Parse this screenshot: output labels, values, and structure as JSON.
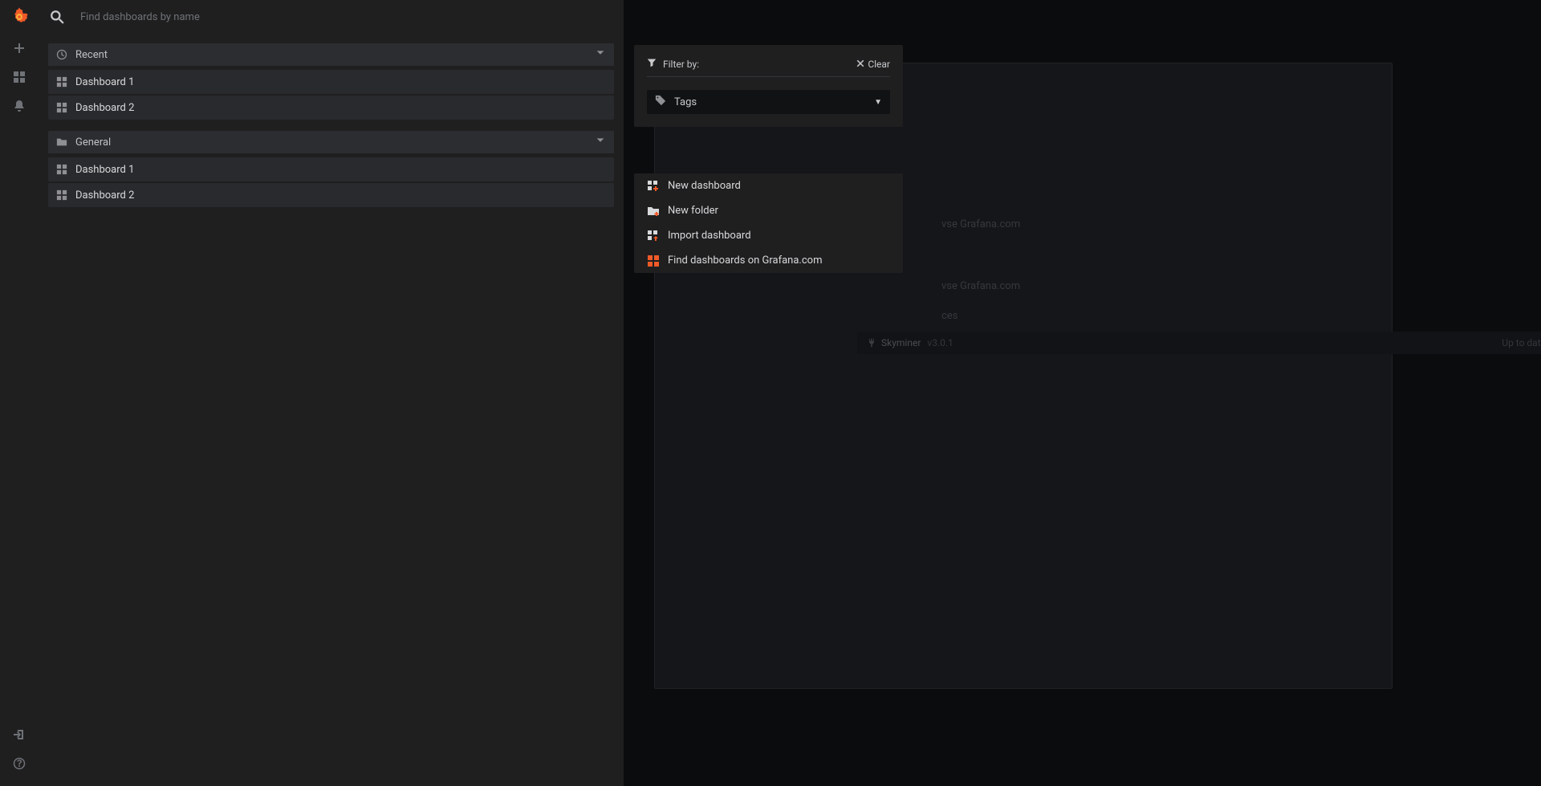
{
  "search": {
    "placeholder": "Find dashboards by name"
  },
  "sections": [
    {
      "key": "recent",
      "title": "Recent",
      "icon": "clock",
      "items": [
        {
          "label": "Dashboard 1"
        },
        {
          "label": "Dashboard 2"
        }
      ]
    },
    {
      "key": "general",
      "title": "General",
      "icon": "folder",
      "items": [
        {
          "label": "Dashboard 1"
        },
        {
          "label": "Dashboard 2"
        }
      ]
    }
  ],
  "filter": {
    "title": "Filter by:",
    "clear": "Clear",
    "tags_label": "Tags"
  },
  "actions": {
    "new_dashboard": "New dashboard",
    "new_folder": "New folder",
    "import_dashboard": "Import dashboard",
    "find_on_grafana": "Find dashboards on Grafana.com"
  },
  "background": {
    "browse1": "vse Grafana.com",
    "browse2": "vse Grafana.com",
    "datasources_heading": "ces",
    "datasource_name": "Skyminer",
    "datasource_version": "v3.0.1",
    "datasource_status": "Up to date"
  }
}
